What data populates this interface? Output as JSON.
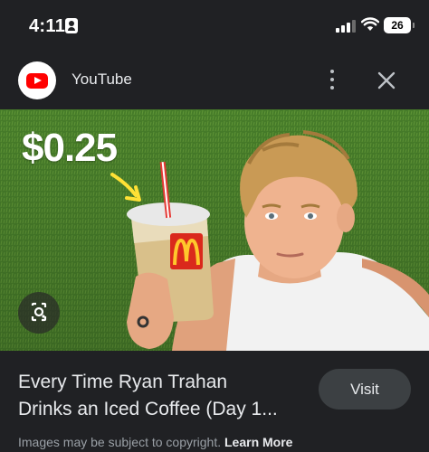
{
  "status_bar": {
    "time": "4:11",
    "battery_level": "26",
    "icons": [
      "person-badge-icon",
      "cellular-signal-icon",
      "wifi-icon",
      "battery-icon"
    ]
  },
  "header": {
    "source_name": "YouTube",
    "source_icon": "youtube-logo",
    "menu_icon": "more-vertical-icon",
    "close_icon": "close-icon"
  },
  "image": {
    "overlay_text": "$0.25",
    "lens_icon": "google-lens-icon",
    "colors": {
      "grass": "#4e8a2e",
      "cup": "#d9c08a",
      "mcd_red": "#da291c",
      "mcd_yellow": "#ffc72c",
      "arrow": "#ffe135"
    }
  },
  "result": {
    "title_line1": "Every Time Ryan Trahan",
    "title_line2": "Drinks an Iced Coffee (Day 1...",
    "visit_label": "Visit"
  },
  "footer": {
    "copyright_text": "Images may be subject to copyright.",
    "learn_more_label": "Learn More"
  },
  "colors": {
    "background": "#202124",
    "button_bg": "#3c4043",
    "muted_text": "#9aa0a6"
  }
}
